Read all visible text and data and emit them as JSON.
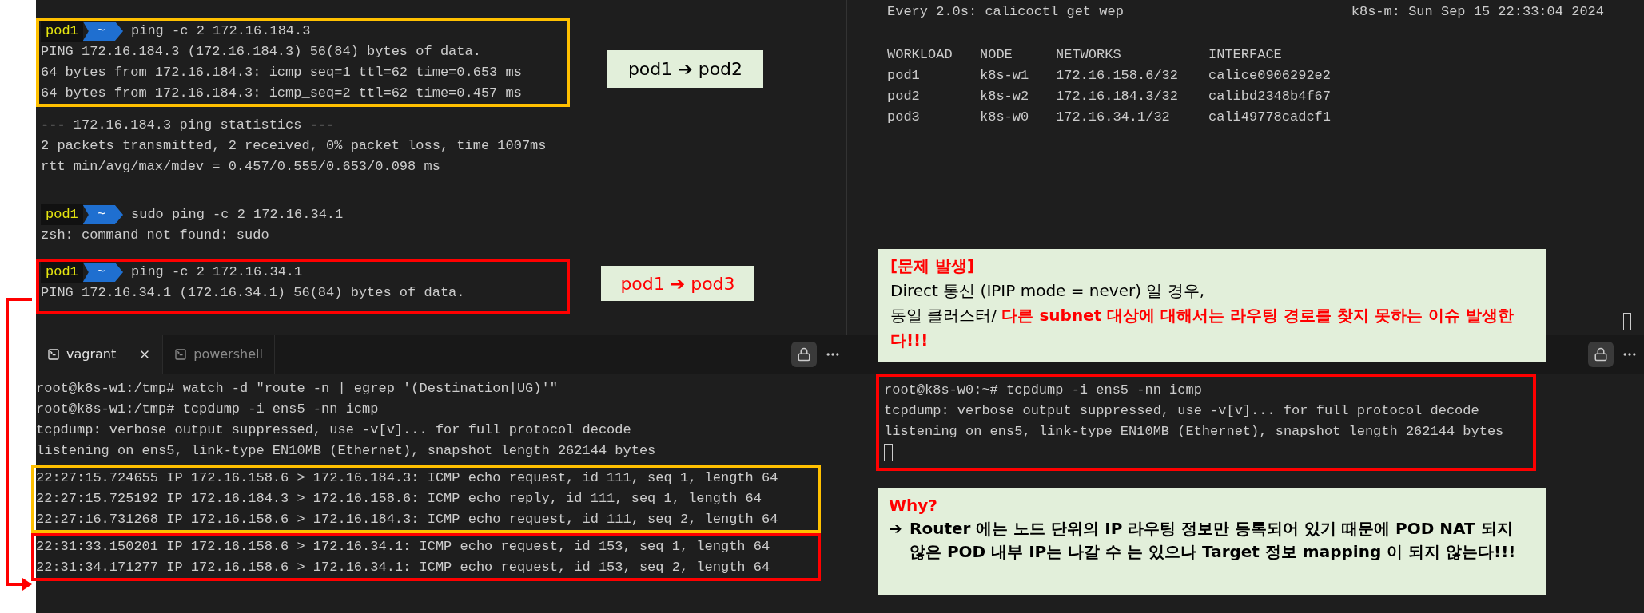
{
  "top_left_terminal": {
    "blocks": [
      {
        "color": "#ffc000",
        "lines": [
          {
            "kind": "prompt",
            "user": "pod1",
            "directory": "~",
            "command": "ping -c 2 172.16.184.3"
          },
          {
            "kind": "output",
            "text": "PING 172.16.184.3 (172.16.184.3) 56(84) bytes of data."
          },
          {
            "kind": "output",
            "text": "64 bytes from 172.16.184.3: icmp_seq=1 ttl=62 time=0.653 ms"
          },
          {
            "kind": "output",
            "text": "64 bytes from 172.16.184.3: icmp_seq=2 ttl=62 time=0.457 ms"
          }
        ]
      },
      {
        "lines": [
          {
            "kind": "output",
            "text": "--- 172.16.184.3 ping statistics ---"
          },
          {
            "kind": "output",
            "text": "2 packets transmitted, 2 received, 0% packet loss, time 1007ms"
          },
          {
            "kind": "output",
            "text": "rtt min/avg/max/mdev = 0.457/0.555/0.653/0.098 ms"
          }
        ]
      },
      {
        "lines": [
          {
            "kind": "prompt",
            "user": "pod1",
            "directory": "~",
            "command": "sudo ping -c 2 172.16.34.1"
          },
          {
            "kind": "output",
            "text": "zsh: command not found: sudo"
          }
        ]
      },
      {
        "color": "#ff0000",
        "lines": [
          {
            "kind": "prompt",
            "user": "pod1",
            "directory": "~",
            "command": "ping -c 2 172.16.34.1"
          },
          {
            "kind": "output",
            "text": "PING 172.16.34.1 (172.16.34.1) 56(84) bytes of data."
          }
        ]
      }
    ]
  },
  "annotations": [
    {
      "text": "pod1 ➔ pod2",
      "color": "#000000"
    },
    {
      "text": "pod1 ➔ pod3",
      "color": "#ff0000"
    }
  ],
  "watch_terminal": {
    "header": "Every 2.0s: calicoctl get wep",
    "host_time": "k8s-m: Sun Sep 15 22:33:04 2024",
    "columns": [
      "WORKLOAD",
      "NODE",
      "NETWORKS",
      "INTERFACE"
    ],
    "rows": [
      [
        "pod1",
        "k8s-w1",
        "172.16.158.6/32",
        "calice0906292e2"
      ],
      [
        "pod2",
        "k8s-w2",
        "172.16.184.3/32",
        "calibd2348b4f67"
      ],
      [
        "pod3",
        "k8s-w0",
        "172.16.34.1/32",
        "cali49778cadcf1"
      ]
    ]
  },
  "problem_note": {
    "title": "[문제 발생]",
    "lines": [
      "Direct 통신 (IPIP mode = never) 일 경우,",
      "동일 클러스터/ **다른 subnet 대상에 대해서는 라우팅 경로를 찾지 못하는 이슈 발생한다!!!**"
    ]
  },
  "bottom_left_terminal": {
    "tabs": [
      {
        "label": "vagrant",
        "selected": true
      },
      {
        "label": "powershell",
        "selected": false
      }
    ],
    "blocks": [
      {
        "lines": [
          {
            "kind": "output",
            "text": "root@k8s-w1:/tmp# watch -d \"route -n | egrep '(Destination|UG)'\""
          },
          {
            "kind": "output",
            "text": "root@k8s-w1:/tmp# tcpdump -i ens5 -nn icmp"
          },
          {
            "kind": "output",
            "text": "tcpdump: verbose output suppressed, use -v[v]... for full protocol decode"
          },
          {
            "kind": "output",
            "text": "listening on ens5, link-type EN10MB (Ethernet), snapshot length 262144 bytes"
          }
        ]
      },
      {
        "color": "#ffc000",
        "lines": [
          {
            "kind": "output",
            "text": "22:27:15.724655 IP 172.16.158.6 > 172.16.184.3: ICMP echo request, id 111, seq 1, length 64"
          },
          {
            "kind": "output",
            "text": "22:27:15.725192 IP 172.16.184.3 > 172.16.158.6: ICMP echo reply, id 111, seq 1, length 64"
          },
          {
            "kind": "output",
            "text": "22:27:16.731268 IP 172.16.158.6 > 172.16.184.3: ICMP echo request, id 111, seq 2, length 64"
          }
        ]
      },
      {
        "color": "#ff0000",
        "lines": [
          {
            "kind": "output",
            "text": "22:31:33.150201 IP 172.16.158.6 > 172.16.34.1: ICMP echo request, id 153, seq 1, length 64"
          },
          {
            "kind": "output",
            "text": "22:31:34.171277 IP 172.16.158.6 > 172.16.34.1: ICMP echo request, id 153, seq 2, length 64"
          }
        ]
      }
    ]
  },
  "bottom_right_terminal": {
    "blocks": [
      {
        "color": "#ff0000",
        "cursor": true,
        "lines": [
          {
            "kind": "output",
            "text": "root@k8s-w0:~# tcpdump -i ens5 -nn icmp"
          },
          {
            "kind": "output",
            "text": "tcpdump: verbose output suppressed, use -v[v]... for full protocol decode"
          },
          {
            "kind": "output",
            "text": "listening on ens5, link-type EN10MB (Ethernet), snapshot length 262144 bytes"
          }
        ]
      }
    ]
  },
  "why_note": {
    "title": "Why?",
    "arrow": "➔",
    "text": "Router 에는 노드 단위의 IP 라우팅 정보만 등록되어 있기 때문에 POD NAT 되지 않은 POD 내부 IP는 나갈 수 는 있으나 Target 정보 mapping 이 되지 않는다!!!"
  }
}
